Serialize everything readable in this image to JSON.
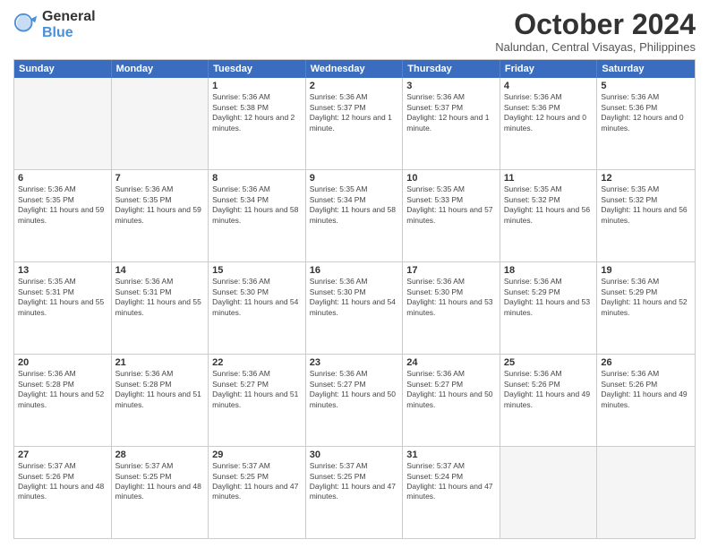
{
  "logo": {
    "general": "General",
    "blue": "Blue"
  },
  "header": {
    "month": "October 2024",
    "location": "Nalundan, Central Visayas, Philippines"
  },
  "days": [
    "Sunday",
    "Monday",
    "Tuesday",
    "Wednesday",
    "Thursday",
    "Friday",
    "Saturday"
  ],
  "weeks": [
    [
      {
        "day": "",
        "sunrise": "",
        "sunset": "",
        "daylight": "",
        "empty": true
      },
      {
        "day": "",
        "sunrise": "",
        "sunset": "",
        "daylight": "",
        "empty": true
      },
      {
        "day": "1",
        "sunrise": "Sunrise: 5:36 AM",
        "sunset": "Sunset: 5:38 PM",
        "daylight": "Daylight: 12 hours and 2 minutes.",
        "empty": false
      },
      {
        "day": "2",
        "sunrise": "Sunrise: 5:36 AM",
        "sunset": "Sunset: 5:37 PM",
        "daylight": "Daylight: 12 hours and 1 minute.",
        "empty": false
      },
      {
        "day": "3",
        "sunrise": "Sunrise: 5:36 AM",
        "sunset": "Sunset: 5:37 PM",
        "daylight": "Daylight: 12 hours and 1 minute.",
        "empty": false
      },
      {
        "day": "4",
        "sunrise": "Sunrise: 5:36 AM",
        "sunset": "Sunset: 5:36 PM",
        "daylight": "Daylight: 12 hours and 0 minutes.",
        "empty": false
      },
      {
        "day": "5",
        "sunrise": "Sunrise: 5:36 AM",
        "sunset": "Sunset: 5:36 PM",
        "daylight": "Daylight: 12 hours and 0 minutes.",
        "empty": false
      }
    ],
    [
      {
        "day": "6",
        "sunrise": "Sunrise: 5:36 AM",
        "sunset": "Sunset: 5:35 PM",
        "daylight": "Daylight: 11 hours and 59 minutes.",
        "empty": false
      },
      {
        "day": "7",
        "sunrise": "Sunrise: 5:36 AM",
        "sunset": "Sunset: 5:35 PM",
        "daylight": "Daylight: 11 hours and 59 minutes.",
        "empty": false
      },
      {
        "day": "8",
        "sunrise": "Sunrise: 5:36 AM",
        "sunset": "Sunset: 5:34 PM",
        "daylight": "Daylight: 11 hours and 58 minutes.",
        "empty": false
      },
      {
        "day": "9",
        "sunrise": "Sunrise: 5:35 AM",
        "sunset": "Sunset: 5:34 PM",
        "daylight": "Daylight: 11 hours and 58 minutes.",
        "empty": false
      },
      {
        "day": "10",
        "sunrise": "Sunrise: 5:35 AM",
        "sunset": "Sunset: 5:33 PM",
        "daylight": "Daylight: 11 hours and 57 minutes.",
        "empty": false
      },
      {
        "day": "11",
        "sunrise": "Sunrise: 5:35 AM",
        "sunset": "Sunset: 5:32 PM",
        "daylight": "Daylight: 11 hours and 56 minutes.",
        "empty": false
      },
      {
        "day": "12",
        "sunrise": "Sunrise: 5:35 AM",
        "sunset": "Sunset: 5:32 PM",
        "daylight": "Daylight: 11 hours and 56 minutes.",
        "empty": false
      }
    ],
    [
      {
        "day": "13",
        "sunrise": "Sunrise: 5:35 AM",
        "sunset": "Sunset: 5:31 PM",
        "daylight": "Daylight: 11 hours and 55 minutes.",
        "empty": false
      },
      {
        "day": "14",
        "sunrise": "Sunrise: 5:36 AM",
        "sunset": "Sunset: 5:31 PM",
        "daylight": "Daylight: 11 hours and 55 minutes.",
        "empty": false
      },
      {
        "day": "15",
        "sunrise": "Sunrise: 5:36 AM",
        "sunset": "Sunset: 5:30 PM",
        "daylight": "Daylight: 11 hours and 54 minutes.",
        "empty": false
      },
      {
        "day": "16",
        "sunrise": "Sunrise: 5:36 AM",
        "sunset": "Sunset: 5:30 PM",
        "daylight": "Daylight: 11 hours and 54 minutes.",
        "empty": false
      },
      {
        "day": "17",
        "sunrise": "Sunrise: 5:36 AM",
        "sunset": "Sunset: 5:30 PM",
        "daylight": "Daylight: 11 hours and 53 minutes.",
        "empty": false
      },
      {
        "day": "18",
        "sunrise": "Sunrise: 5:36 AM",
        "sunset": "Sunset: 5:29 PM",
        "daylight": "Daylight: 11 hours and 53 minutes.",
        "empty": false
      },
      {
        "day": "19",
        "sunrise": "Sunrise: 5:36 AM",
        "sunset": "Sunset: 5:29 PM",
        "daylight": "Daylight: 11 hours and 52 minutes.",
        "empty": false
      }
    ],
    [
      {
        "day": "20",
        "sunrise": "Sunrise: 5:36 AM",
        "sunset": "Sunset: 5:28 PM",
        "daylight": "Daylight: 11 hours and 52 minutes.",
        "empty": false
      },
      {
        "day": "21",
        "sunrise": "Sunrise: 5:36 AM",
        "sunset": "Sunset: 5:28 PM",
        "daylight": "Daylight: 11 hours and 51 minutes.",
        "empty": false
      },
      {
        "day": "22",
        "sunrise": "Sunrise: 5:36 AM",
        "sunset": "Sunset: 5:27 PM",
        "daylight": "Daylight: 11 hours and 51 minutes.",
        "empty": false
      },
      {
        "day": "23",
        "sunrise": "Sunrise: 5:36 AM",
        "sunset": "Sunset: 5:27 PM",
        "daylight": "Daylight: 11 hours and 50 minutes.",
        "empty": false
      },
      {
        "day": "24",
        "sunrise": "Sunrise: 5:36 AM",
        "sunset": "Sunset: 5:27 PM",
        "daylight": "Daylight: 11 hours and 50 minutes.",
        "empty": false
      },
      {
        "day": "25",
        "sunrise": "Sunrise: 5:36 AM",
        "sunset": "Sunset: 5:26 PM",
        "daylight": "Daylight: 11 hours and 49 minutes.",
        "empty": false
      },
      {
        "day": "26",
        "sunrise": "Sunrise: 5:36 AM",
        "sunset": "Sunset: 5:26 PM",
        "daylight": "Daylight: 11 hours and 49 minutes.",
        "empty": false
      }
    ],
    [
      {
        "day": "27",
        "sunrise": "Sunrise: 5:37 AM",
        "sunset": "Sunset: 5:26 PM",
        "daylight": "Daylight: 11 hours and 48 minutes.",
        "empty": false
      },
      {
        "day": "28",
        "sunrise": "Sunrise: 5:37 AM",
        "sunset": "Sunset: 5:25 PM",
        "daylight": "Daylight: 11 hours and 48 minutes.",
        "empty": false
      },
      {
        "day": "29",
        "sunrise": "Sunrise: 5:37 AM",
        "sunset": "Sunset: 5:25 PM",
        "daylight": "Daylight: 11 hours and 47 minutes.",
        "empty": false
      },
      {
        "day": "30",
        "sunrise": "Sunrise: 5:37 AM",
        "sunset": "Sunset: 5:25 PM",
        "daylight": "Daylight: 11 hours and 47 minutes.",
        "empty": false
      },
      {
        "day": "31",
        "sunrise": "Sunrise: 5:37 AM",
        "sunset": "Sunset: 5:24 PM",
        "daylight": "Daylight: 11 hours and 47 minutes.",
        "empty": false
      },
      {
        "day": "",
        "sunrise": "",
        "sunset": "",
        "daylight": "",
        "empty": true
      },
      {
        "day": "",
        "sunrise": "",
        "sunset": "",
        "daylight": "",
        "empty": true
      }
    ]
  ]
}
